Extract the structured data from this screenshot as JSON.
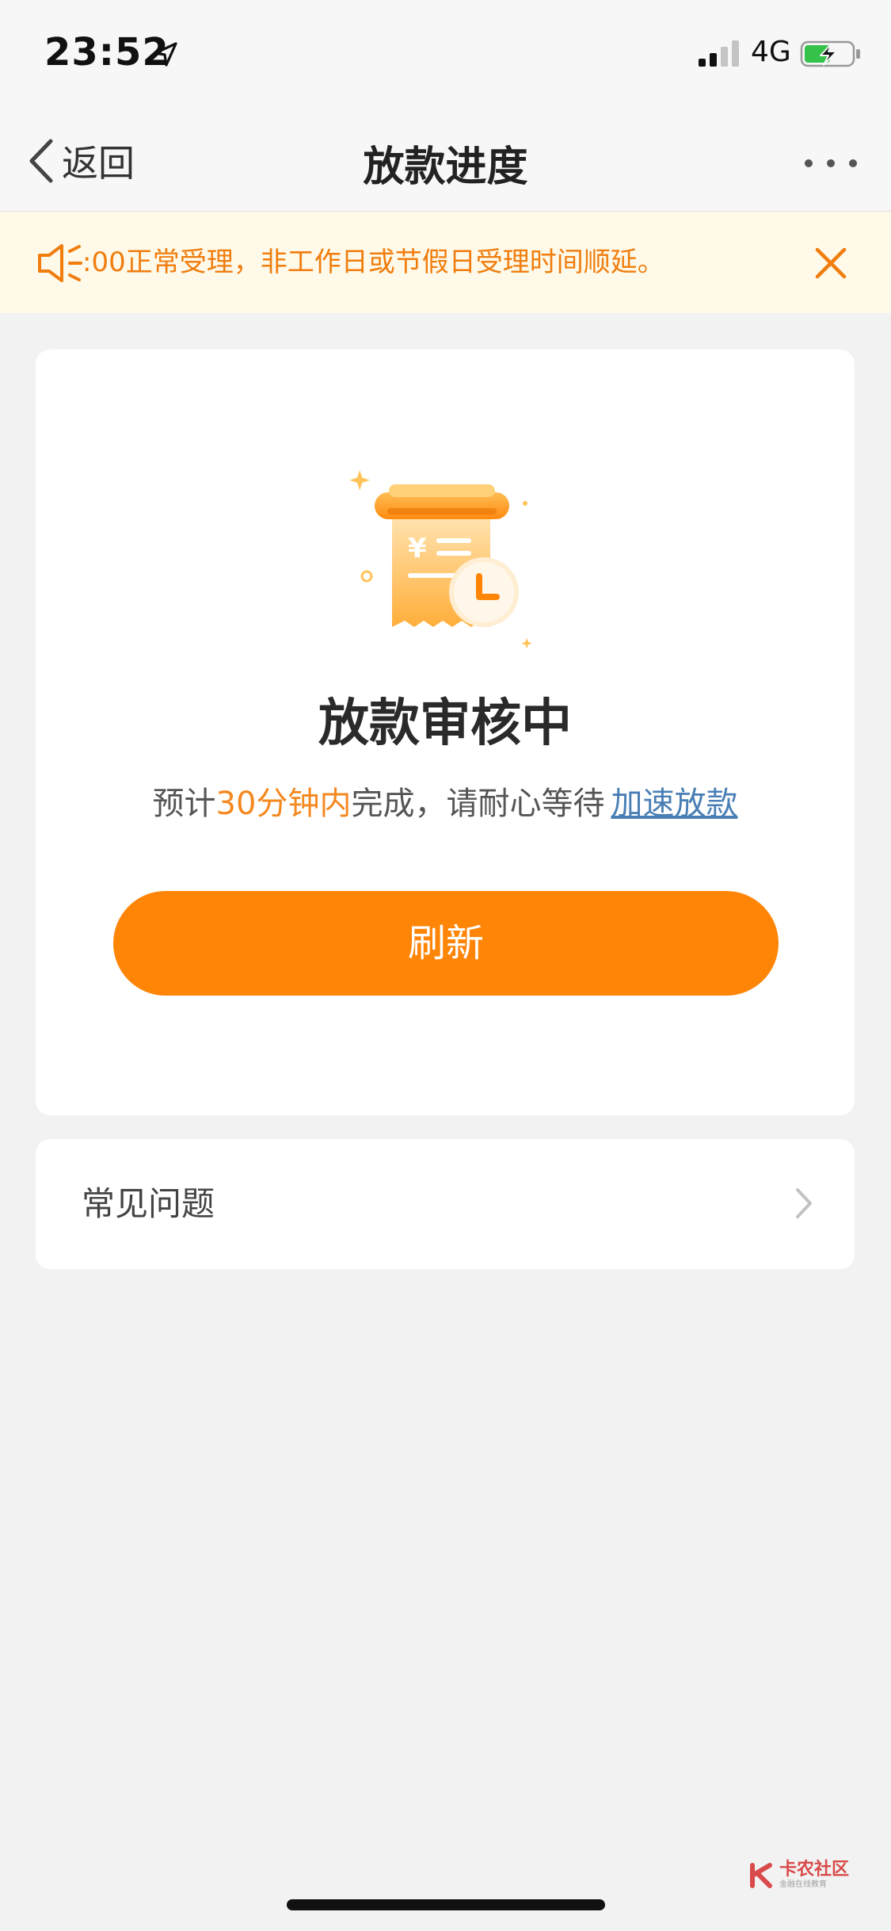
{
  "status_bar": {
    "time": "23:52",
    "network": "4G",
    "icons": [
      "location-arrow-icon",
      "signal-icon",
      "battery-charging-icon"
    ]
  },
  "nav": {
    "back_label": "返回",
    "title": "放款进度",
    "back_icon": "chevron-left-icon",
    "more_icon": "more-dots-icon"
  },
  "notice": {
    "text": ":00正常受理，非工作日或节假日受理时间顺延。",
    "icon": "speaker-icon",
    "close_icon": "close-icon"
  },
  "status_card": {
    "illustration": "receipt-clock-icon",
    "title": "放款审核中",
    "desc_prefix": "预计",
    "desc_highlight": "30分钟内",
    "desc_suffix": "完成，请耐心等待",
    "link_label": "加速放款",
    "refresh_label": "刷新"
  },
  "faq": {
    "label": "常见问题",
    "icon": "chevron-right-icon"
  },
  "watermark": {
    "main": "卡农社区",
    "sub": "金融在线教育"
  },
  "colors": {
    "accent": "#ff8507",
    "highlight": "#f5881f",
    "link": "#4a7fb5",
    "notice_bg": "#fef9e8",
    "page_bg": "#f2f2f2"
  }
}
